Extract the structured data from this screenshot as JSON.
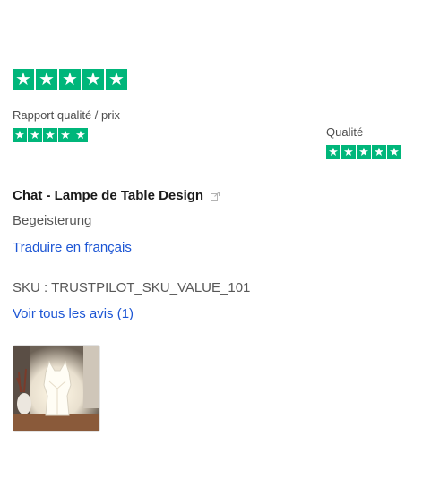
{
  "overall_rating": {
    "stars": 5
  },
  "sub_ratings": [
    {
      "label": "Rapport qualité / prix",
      "stars": 5
    },
    {
      "label": "Qualité",
      "stars": 5
    }
  ],
  "product": {
    "name": "Chat - Lampe de Table Design",
    "external_link_icon": "external-link-icon"
  },
  "review": {
    "text": "Begeisterung",
    "translate_label": "Traduire en français"
  },
  "sku": {
    "text": "SKU : TRUSTPILOT_SKU_VALUE_101"
  },
  "all_reviews_label": "Voir tous les avis (1)",
  "colors": {
    "star_green": "#00b67a",
    "link_blue": "#1c55d4"
  },
  "photo": {
    "icon": "review-photo-thumbnail"
  }
}
